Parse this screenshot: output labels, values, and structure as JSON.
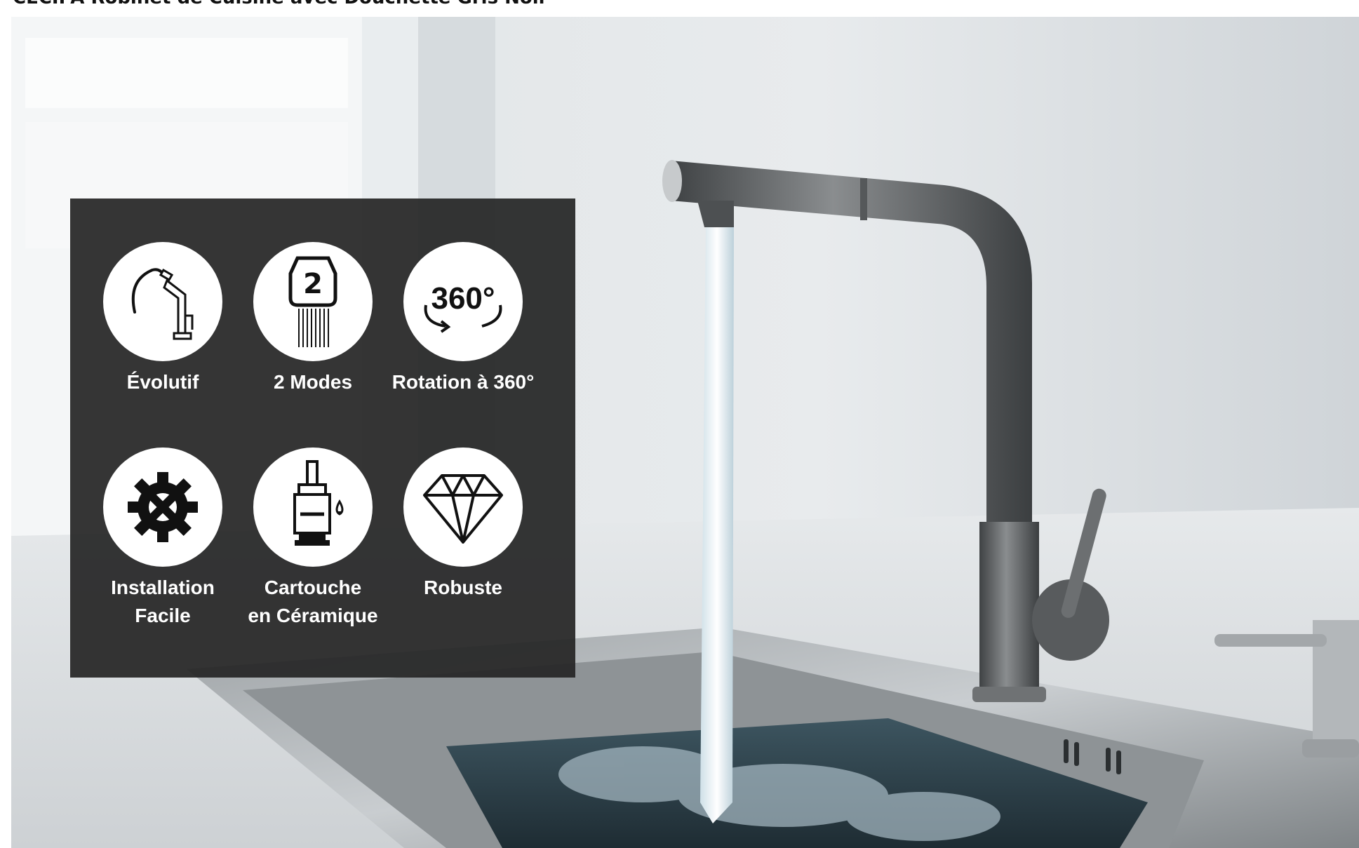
{
  "page": {
    "title": "CECIPA Robinet de Cuisine avec Douchette Gris Noir"
  },
  "features": [
    {
      "label": "Évolutif",
      "icon": "pull-out-faucet-icon"
    },
    {
      "label": "2 Modes",
      "icon": "two-spray-modes-icon"
    },
    {
      "label": "Rotation à 360°",
      "icon": "rotation-360-icon",
      "icon_text": "360°"
    },
    {
      "label": "Installation\nFacile",
      "icon": "gear-wrench-icon"
    },
    {
      "label": "Cartouche\nen Céramique",
      "icon": "ceramic-cartridge-icon"
    },
    {
      "label": "Robuste",
      "icon": "diamond-icon"
    }
  ],
  "colors": {
    "panel_background": "#262626",
    "icon_circle": "#ffffff",
    "label_text": "#ffffff",
    "faucet": "#5c5f61"
  }
}
